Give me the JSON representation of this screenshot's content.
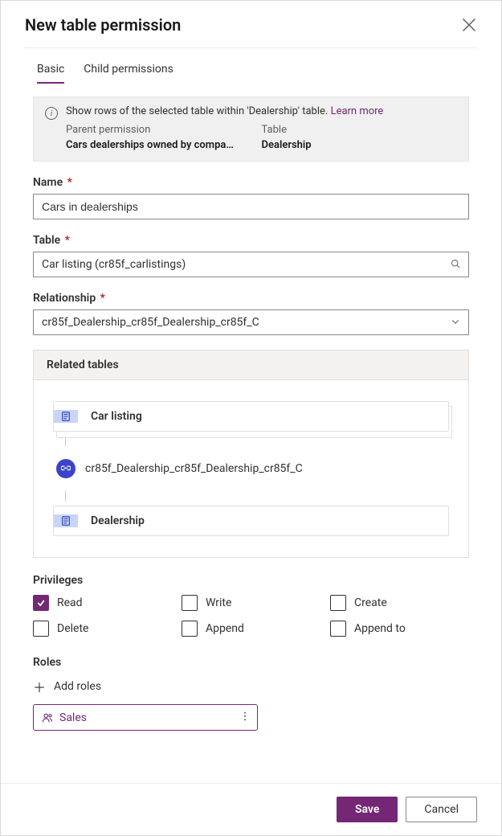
{
  "header": {
    "title": "New table permission"
  },
  "tabs": {
    "basic": "Basic",
    "child": "Child permissions"
  },
  "infobox": {
    "text_prefix": "Show rows of the selected table within 'Dealership' table. ",
    "learn_more": "Learn more",
    "parent_label": "Parent permission",
    "parent_value": "Cars dealerships owned by compa…",
    "table_label": "Table",
    "table_value": "Dealership"
  },
  "fields": {
    "name_label": "Name",
    "name_value": "Cars in dealerships",
    "table_label": "Table",
    "table_value": "Car listing (cr85f_carlistings)",
    "relationship_label": "Relationship",
    "relationship_value": "cr85f_Dealership_cr85f_Dealership_cr85f_C"
  },
  "related": {
    "heading": "Related tables",
    "card1": "Car listing",
    "link": "cr85f_Dealership_cr85f_Dealership_cr85f_C",
    "card2": "Dealership"
  },
  "privileges": {
    "heading": "Privileges",
    "items": [
      {
        "key": "read",
        "label": "Read",
        "checked": true
      },
      {
        "key": "write",
        "label": "Write",
        "checked": false
      },
      {
        "key": "create",
        "label": "Create",
        "checked": false
      },
      {
        "key": "delete",
        "label": "Delete",
        "checked": false
      },
      {
        "key": "append",
        "label": "Append",
        "checked": false
      },
      {
        "key": "appendto",
        "label": "Append to",
        "checked": false
      }
    ]
  },
  "roles": {
    "heading": "Roles",
    "add_label": "Add roles",
    "chip": "Sales"
  },
  "footer": {
    "save": "Save",
    "cancel": "Cancel"
  }
}
